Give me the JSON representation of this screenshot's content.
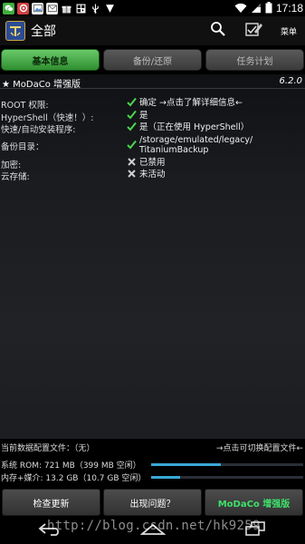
{
  "status_bar": {
    "time": "17:18",
    "notification_icons": [
      "wechat-icon",
      "settings-app-icon",
      "image-icon",
      "mail-icon",
      "gift-icon",
      "qr-icon",
      "usb-icon",
      "more-icon"
    ],
    "system_icons": [
      "wifi-icon",
      "signal-icon",
      "battery-icon"
    ]
  },
  "action_bar": {
    "title": "全部",
    "menu_label": "菜单"
  },
  "tabs": [
    {
      "label": "基本信息",
      "active": true
    },
    {
      "label": "备份/还原",
      "active": false
    },
    {
      "label": "任务计划",
      "active": false
    }
  ],
  "heading": {
    "left": "★ MoDaCo 增强版",
    "right": "6.2.0"
  },
  "info_rows": [
    {
      "label": "ROOT 权限:",
      "icon": "check",
      "value": "确定 →点击了解详细信息←"
    },
    {
      "label": "HyperShell（快速！）:",
      "icon": "check",
      "value": "是"
    },
    {
      "label": "快速/自动安装程序:",
      "icon": "check",
      "value": "是（正在使用 HyperShell）"
    },
    {
      "label": "备份目录：",
      "icon": "check",
      "value_lines": [
        "/storage/emulated/legacy/",
        "TitaniumBackup"
      ]
    },
    {
      "label": "加密:",
      "icon": "cross",
      "value": "已禁用"
    },
    {
      "label": "云存储:",
      "icon": "cross",
      "value": "未活动"
    }
  ],
  "config": {
    "left": "当前数据配置文件：（无）",
    "right": "→点击可切换配置文件←"
  },
  "storage": [
    {
      "label": "系统 ROM:  721 MB（399 MB 空闲）",
      "used_fraction": 0.46
    },
    {
      "label": "内存+媒介: 13.2 GB（10.7 GB 空闲）",
      "used_fraction": 0.19
    }
  ],
  "buttons": {
    "check_update": "检查更新",
    "problem": "出现问题？",
    "modaco": "MoDaCo 增强版"
  },
  "watermark": "http://blog.csdn.net/hk9259",
  "colors": {
    "accent_green": "#3ee06a",
    "tab_active": "#4cb04c",
    "progress": "#3aa7d6"
  }
}
